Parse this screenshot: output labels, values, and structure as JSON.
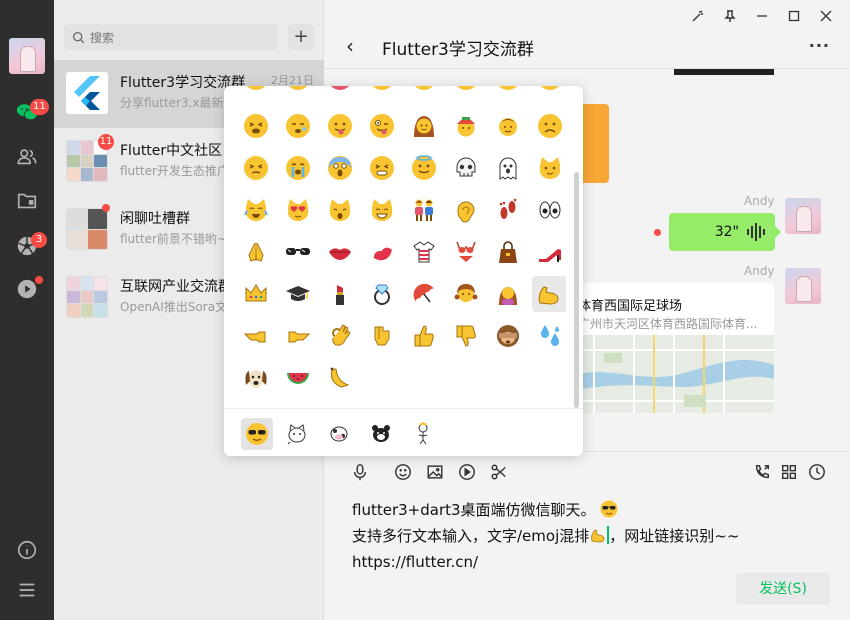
{
  "nav": {
    "items": [
      {
        "name": "chat-icon",
        "badge": "11"
      },
      {
        "name": "contacts-icon"
      },
      {
        "name": "favorites-folder-icon"
      },
      {
        "name": "moments-aperture-icon",
        "badge": "3"
      },
      {
        "name": "video-play-icon",
        "dot": true
      }
    ],
    "bottom": [
      "info-icon",
      "menu-icon"
    ]
  },
  "list": {
    "search_placeholder": "搜索",
    "add_label": "+",
    "conversations": [
      {
        "name": "Flutter3学习交流群",
        "time": "2月21日",
        "preview": "分享flutter3.x最新...",
        "active": true
      },
      {
        "name": "Flutter中文社区",
        "time": "",
        "preview": "flutter开发生态推广...",
        "badge": "11"
      },
      {
        "name": "闲聊吐槽群",
        "time": "",
        "preview": "flutter前景不错哟~",
        "dot": true
      },
      {
        "name": "互联网产业交流群",
        "time": "",
        "preview": "OpenAI推出Sora文..."
      }
    ]
  },
  "chat": {
    "title": "Flutter3学习交流群",
    "back": "‹",
    "more": "···",
    "window_controls": [
      "pin-icon",
      "pushpin-icon",
      "minimize-icon",
      "maximize-icon",
      "close-icon"
    ],
    "messages": {
      "sender1": "Andy",
      "voice_duration": "32\"",
      "sender2": "Andy",
      "location_title": "体育西国际足球场",
      "location_address": "广州市天河区体育西路国际体育..."
    },
    "toolbar": [
      "mic-icon",
      "smile-icon",
      "image-icon",
      "play-icon",
      "scissors-icon"
    ],
    "toolbar_right": [
      "call-icon",
      "apps-icon",
      "history-clock-icon"
    ],
    "editor": {
      "line1": "flutter3+dart3桌面端仿微信聊天。",
      "line2a": "支持多行文本输入，文字/emoj混排",
      "line2b": "，网址链接识别~~",
      "line3": "https://flutter.cn/"
    },
    "send_label": "发送(S)"
  },
  "emoji": {
    "rows": [
      [
        "tired",
        "sleepy",
        "tongue",
        "crazy",
        "woman",
        "boy-cap",
        "boy",
        "worried"
      ],
      [
        "persevere",
        "sob",
        "scream",
        "tired-grin",
        "halo",
        "skull",
        "ghost",
        "cat"
      ],
      [
        "cat-joy",
        "cat-heart",
        "cat-weary",
        "cat-smile",
        "couple",
        "ear",
        "footprints",
        "eyes"
      ],
      [
        "pray",
        "sunglasses",
        "lips",
        "kiss-mark",
        "shirt",
        "bikini",
        "handbag",
        "heel"
      ],
      [
        "crown",
        "grad-cap",
        "lipstick",
        "ring",
        "umbrella",
        "girl",
        "woman-raise",
        "muscle"
      ],
      [
        "point-left",
        "point-right",
        "ok-hand",
        "thumb-point",
        "thumbs-up",
        "thumbs-down",
        "see-no-evil",
        "sweat-drops"
      ],
      [
        "dog",
        "watermelon",
        "banana"
      ]
    ],
    "tabs": [
      "emoji-face-tab",
      "sticker-cat-tab",
      "sticker-cow-tab",
      "sticker-bear-tab",
      "sticker-figure-tab"
    ]
  },
  "colors": {
    "accent_green": "#07c160",
    "voice_bubble": "#95ec69",
    "badge_red": "#f74c46",
    "emoji_yellow": "#f9c432"
  }
}
